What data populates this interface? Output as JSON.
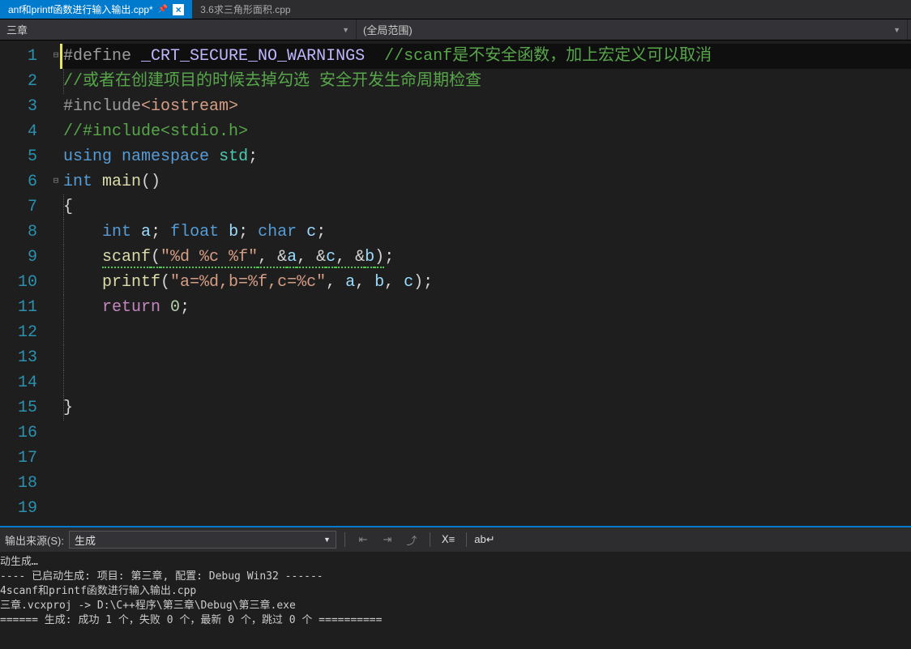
{
  "tabs": [
    {
      "label": "anf和printf函数进行输入输出.cpp*",
      "active": true
    },
    {
      "label": "3.6求三角形面积.cpp",
      "active": false
    }
  ],
  "nav": {
    "left": "三章",
    "right": "(全局范围)"
  },
  "code": {
    "lines": [
      {
        "n": "1",
        "fold": "⊟",
        "hl": true,
        "margin": true,
        "seg": [
          {
            "t": "#define",
            "c": "def"
          },
          {
            "t": " "
          },
          {
            "t": "_CRT_SECURE_NO_WARNINGS",
            "c": "mac"
          },
          {
            "t": "  "
          },
          {
            "t": "//scanf是不安全函数，加上宏定义可以取消",
            "c": "cmt"
          }
        ]
      },
      {
        "n": "2",
        "g": 0,
        "seg": [
          {
            "t": "//或者在创建项目的时候去掉勾选 安全开发生命周期检查",
            "c": "cmt"
          }
        ]
      },
      {
        "n": "3",
        "seg": [
          {
            "t": "#include",
            "c": "def"
          },
          {
            "t": "<iostream>",
            "c": "str"
          }
        ]
      },
      {
        "n": "4",
        "seg": [
          {
            "t": "//#include<stdio.h>",
            "c": "cmt"
          }
        ]
      },
      {
        "n": "5",
        "seg": [
          {
            "t": "using",
            "c": "kw"
          },
          {
            "t": " "
          },
          {
            "t": "namespace",
            "c": "kw"
          },
          {
            "t": " "
          },
          {
            "t": "std",
            "c": "typ"
          },
          {
            "t": ";",
            "c": "punc"
          }
        ]
      },
      {
        "n": "6",
        "fold": "⊟",
        "seg": [
          {
            "t": "int",
            "c": "kw"
          },
          {
            "t": " "
          },
          {
            "t": "main",
            "c": "fn"
          },
          {
            "t": "()",
            "c": "punc"
          }
        ]
      },
      {
        "n": "7",
        "g": 0,
        "seg": [
          {
            "t": "{",
            "c": "punc"
          }
        ]
      },
      {
        "n": "8",
        "g": 0,
        "seg": [
          {
            "t": "    "
          },
          {
            "t": "int",
            "c": "kw"
          },
          {
            "t": " "
          },
          {
            "t": "a",
            "c": "var"
          },
          {
            "t": "; ",
            "c": "punc"
          },
          {
            "t": "float",
            "c": "kw"
          },
          {
            "t": " "
          },
          {
            "t": "b",
            "c": "var"
          },
          {
            "t": "; ",
            "c": "punc"
          },
          {
            "t": "char",
            "c": "kw"
          },
          {
            "t": " "
          },
          {
            "t": "c",
            "c": "var"
          },
          {
            "t": ";",
            "c": "punc"
          }
        ]
      },
      {
        "n": "9",
        "g": 0,
        "seg": [
          {
            "t": "    "
          },
          {
            "t": "scanf",
            "c": "fn",
            "w": true
          },
          {
            "t": "(",
            "c": "punc",
            "w": true
          },
          {
            "t": "\"%d %c %f\"",
            "c": "str",
            "w": true
          },
          {
            "t": ", &",
            "c": "punc",
            "w": true
          },
          {
            "t": "a",
            "c": "var",
            "w": true
          },
          {
            "t": ", &",
            "c": "punc",
            "w": true
          },
          {
            "t": "c",
            "c": "var",
            "w": true
          },
          {
            "t": ", &",
            "c": "punc",
            "w": true
          },
          {
            "t": "b",
            "c": "var",
            "w": true
          },
          {
            "t": ")",
            "c": "punc",
            "w": true
          },
          {
            "t": ";",
            "c": "punc"
          }
        ]
      },
      {
        "n": "10",
        "g": 0,
        "seg": [
          {
            "t": "    "
          },
          {
            "t": "printf",
            "c": "fn"
          },
          {
            "t": "(",
            "c": "punc"
          },
          {
            "t": "\"a=%d,b=%f,c=%c\"",
            "c": "str"
          },
          {
            "t": ", ",
            "c": "punc"
          },
          {
            "t": "a",
            "c": "var"
          },
          {
            "t": ", ",
            "c": "punc"
          },
          {
            "t": "b",
            "c": "var"
          },
          {
            "t": ", ",
            "c": "punc"
          },
          {
            "t": "c",
            "c": "var"
          },
          {
            "t": ");",
            "c": "punc"
          }
        ]
      },
      {
        "n": "11",
        "g": 0,
        "seg": [
          {
            "t": "    "
          },
          {
            "t": "return",
            "c": "kw2"
          },
          {
            "t": " "
          },
          {
            "t": "0",
            "c": "num"
          },
          {
            "t": ";",
            "c": "punc"
          }
        ]
      },
      {
        "n": "12",
        "g": 0,
        "seg": []
      },
      {
        "n": "13",
        "g": 0,
        "seg": []
      },
      {
        "n": "14",
        "g": 0,
        "seg": []
      },
      {
        "n": "15",
        "g": 0,
        "seg": [
          {
            "t": "}",
            "c": "punc"
          }
        ]
      },
      {
        "n": "16",
        "seg": []
      },
      {
        "n": "17",
        "seg": []
      },
      {
        "n": "18",
        "seg": []
      },
      {
        "n": "19",
        "seg": []
      }
    ]
  },
  "output": {
    "source_label": "输出来源(S):",
    "source_value": "生成",
    "lines": [
      "动生成…",
      "---- 已启动生成: 项目: 第三章, 配置: Debug Win32 ------",
      "4scanf和printf函数进行输入输出.cpp",
      "三章.vcxproj -> D:\\C++程序\\第三章\\Debug\\第三章.exe",
      "====== 生成: 成功 1 个，失败 0 个，最新 0 个，跳过 0 个 =========="
    ]
  }
}
